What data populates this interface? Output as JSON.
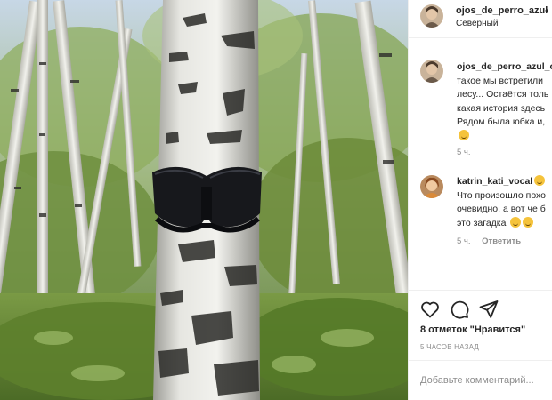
{
  "post": {
    "username": "ojos_de_perro_azul",
    "location": "Северный",
    "photo_alt": ""
  },
  "comments": [
    {
      "username": "ojos_de_perro_azul_c",
      "lines": [
        "такое мы встретили",
        "лесу... Остаётся толь",
        "какая история здесь",
        "Рядом была юбка и,"
      ],
      "emoji_count": 1,
      "time": "5 ч."
    },
    {
      "username": "katrin_kati_vocal",
      "lines": [
        "Что произошло похо",
        "очевидно, а вот че б",
        "это загадка"
      ],
      "emoji_count": 2,
      "time": "5 ч.",
      "reply_label": "Ответить"
    }
  ],
  "actions": {
    "like_icon": "heart-icon",
    "comment_icon": "comment-icon",
    "share_icon": "share-icon"
  },
  "likes_text": "8 отметок \"Нравится\"",
  "time_ago": "5 ЧАСОВ НАЗАД",
  "add_comment_placeholder": "Добавьте комментарий..."
}
